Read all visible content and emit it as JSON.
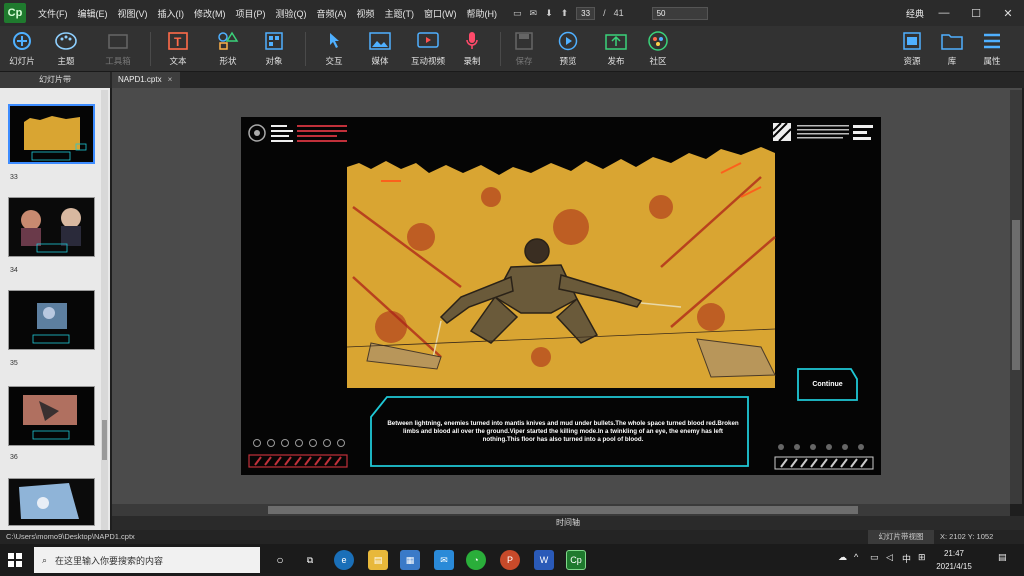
{
  "app": {
    "logo_text": "Cp",
    "mode": "经典"
  },
  "menu": [
    "文件(F)",
    "编辑(E)",
    "视图(V)",
    "插入(I)",
    "修改(M)",
    "项目(P)",
    "测验(Q)",
    "音频(A)",
    "视频",
    "主题(T)",
    "窗口(W)",
    "帮助(H)"
  ],
  "quick": {
    "current_slide": "33",
    "separator": "/",
    "total_slides": "41",
    "zoom": "50"
  },
  "toolbar": {
    "slides": "幻灯片",
    "themes": "主题",
    "toolbox": "工具箱",
    "text": "文本",
    "shapes": "形状",
    "objects": "对象",
    "interactions": "交互",
    "media": "媒体",
    "interactive_video": "互动视频",
    "record": "录制",
    "save": "保存",
    "preview": "预览",
    "publish": "发布",
    "community": "社区",
    "assets": "资源",
    "library": "库",
    "properties": "属性"
  },
  "filmstrip": {
    "header": "幻灯片带",
    "slides": [
      {
        "num": "33",
        "selected": true
      },
      {
        "num": "34",
        "selected": false
      },
      {
        "num": "35",
        "selected": false
      },
      {
        "num": "36",
        "selected": false
      },
      {
        "num": "",
        "selected": false
      }
    ]
  },
  "document_tab": "NAPD1.cptx",
  "slide": {
    "continue_label": "Continue",
    "caption": "Between lightning, enemies turned into mantis knives and mud under bullets.The whole space turned blood red.Broken limbs and blood all over the ground.Viper started the killing mode.In a twinkling of an eye, the enemy has left nothing.This floor has also turned into a pool of blood.",
    "accent_color": "#1fc8d6",
    "art_color": "#d9a532"
  },
  "timeline_label": "时间轴",
  "statusbar": {
    "path": "C:\\Users\\momo9\\Desktop\\NAPD1.cptx",
    "view": "幻灯片带视图",
    "coords": "X: 2102 Y: 1052"
  },
  "taskbar": {
    "search_placeholder": "在这里输入你要搜索的内容",
    "ime": "中",
    "time": "21:47",
    "date": "2021/4/15"
  }
}
